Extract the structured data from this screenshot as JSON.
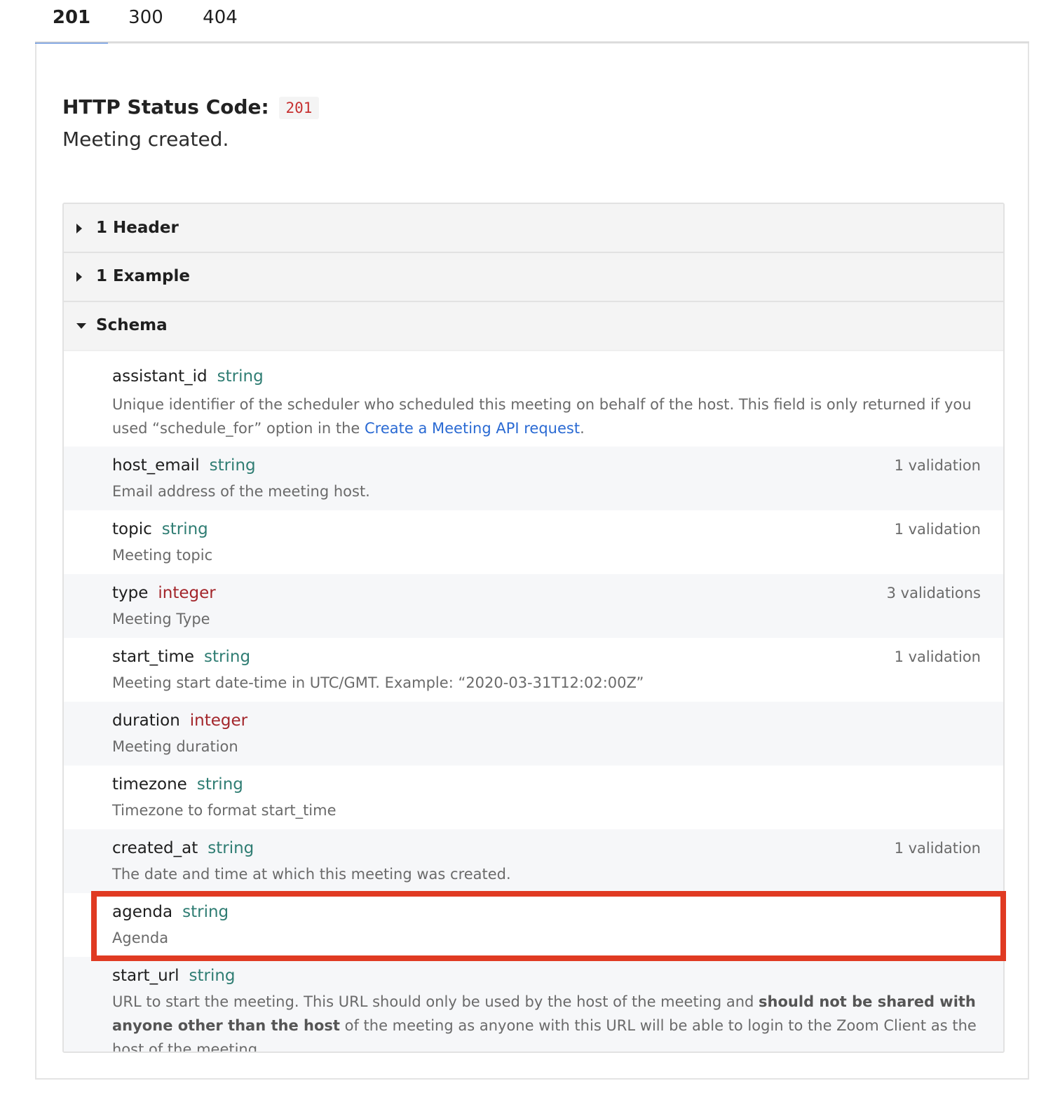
{
  "tabs": [
    {
      "label": "201",
      "active": true
    },
    {
      "label": "300",
      "active": false
    },
    {
      "label": "404",
      "active": false
    }
  ],
  "status": {
    "label": "HTTP Status Code:",
    "code": "201",
    "description": "Meeting created."
  },
  "accordion": {
    "header": "1 Header",
    "example": "1 Example",
    "schema": "Schema"
  },
  "fields": [
    {
      "name": "assistant_id",
      "type": "string",
      "desc_pre": "Unique identifier of the scheduler who scheduled this meeting on behalf of the host. This field is only returned if you used “schedule_for” option in the ",
      "desc_link": "Create a Meeting API request",
      "desc_post": ".",
      "validations": ""
    },
    {
      "name": "host_email",
      "type": "string",
      "desc": "Email address of the meeting host.",
      "validations": "1 validation"
    },
    {
      "name": "topic",
      "type": "string",
      "desc": "Meeting topic",
      "validations": "1 validation"
    },
    {
      "name": "type",
      "type": "integer",
      "desc": "Meeting Type",
      "validations": "3 validations"
    },
    {
      "name": "start_time",
      "type": "string",
      "desc": "Meeting start date-time in UTC/GMT. Example: “2020-03-31T12:02:00Z”",
      "validations": "1 validation"
    },
    {
      "name": "duration",
      "type": "integer",
      "desc": "Meeting duration",
      "validations": ""
    },
    {
      "name": "timezone",
      "type": "string",
      "desc": "Timezone to format start_time",
      "validations": ""
    },
    {
      "name": "created_at",
      "type": "string",
      "desc": "The date and time at which this meeting was created.",
      "validations": "1 validation"
    },
    {
      "name": "agenda",
      "type": "string",
      "desc": "Agenda",
      "validations": "",
      "highlighted": true
    },
    {
      "name": "start_url",
      "type": "string",
      "desc_a": "URL to start the meeting. This URL should only be used by the host of the meeting and ",
      "desc_bold": "should not be shared with anyone other than the host",
      "desc_b": " of the meeting as anyone with this URL will be able to login to the Zoom Client as the host of the meeting.",
      "validations": ""
    }
  ],
  "colors": {
    "accent": "#2a6ad3",
    "string_type": "#2f7d73",
    "integer_type": "#a3262b",
    "highlight": "#e03a22"
  }
}
